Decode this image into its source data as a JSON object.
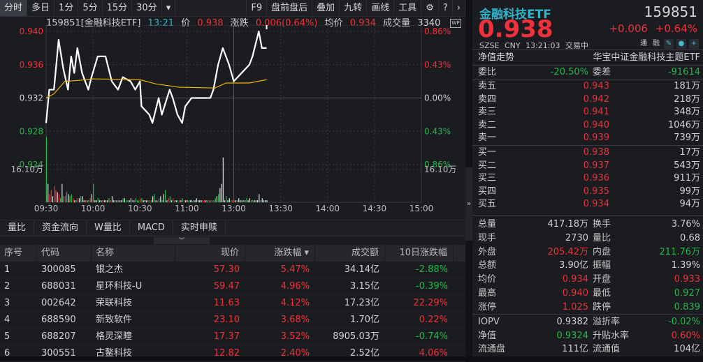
{
  "toolbar": {
    "left": [
      "分时",
      "多日",
      "1分",
      "5分",
      "15分",
      "30分"
    ],
    "more": "▾",
    "right": [
      "F9",
      "盘前盘后",
      "叠加",
      "九转",
      "画线",
      "工具"
    ],
    "icons": [
      "gear-icon",
      "help-icon",
      "chevron-right-icon"
    ]
  },
  "chart_header": {
    "code_name": "159851[金融科技ETF]",
    "time": "13:21",
    "price_label": "价",
    "price": "0.938",
    "change_label": "涨跌",
    "change": "0.006(0.64%)",
    "avg_label": "均价",
    "avg": "0.934",
    "vol_label": "成交量",
    "vol": "3340",
    "wp": "WP"
  },
  "chart_data": {
    "type": "line",
    "title": "159851 分时",
    "x_ticks": [
      "09:30",
      "10:00",
      "10:30",
      "11:00",
      "13:00",
      "13:30",
      "14:00",
      "14:30",
      "15:00"
    ],
    "y_left_ticks": [
      "0.940",
      "0.936",
      "0.932",
      "0.928",
      "0.924"
    ],
    "y_right_ticks": [
      "0.86%",
      "0.43%",
      "0.00%",
      "0.43%",
      "0.86%"
    ],
    "ylim": [
      0.924,
      0.94
    ],
    "prev_close": 0.932,
    "volume_label": "16.10万",
    "volume_ref": 16.1,
    "price": {
      "minutes": [
        0,
        2,
        5,
        8,
        11,
        14,
        16,
        18,
        20,
        23,
        27,
        29,
        33,
        38,
        42,
        46,
        49,
        54,
        57,
        60,
        61,
        66,
        68,
        72,
        74,
        79,
        81,
        84,
        87,
        89,
        93,
        96,
        101,
        105,
        107,
        110,
        113,
        117,
        120,
        125,
        130,
        132,
        136,
        138,
        141
      ],
      "values": [
        0.929,
        0.933,
        0.933,
        0.939,
        0.9355,
        0.933,
        0.937,
        0.935,
        0.938,
        0.935,
        0.933,
        0.9345,
        0.937,
        0.937,
        0.934,
        0.933,
        0.9345,
        0.934,
        0.933,
        0.934,
        0.931,
        0.93,
        0.929,
        0.932,
        0.93,
        0.933,
        0.932,
        0.93,
        0.929,
        0.931,
        0.932,
        0.932,
        0.932,
        0.932,
        0.933,
        0.936,
        0.938,
        0.936,
        0.934,
        0.935,
        0.936,
        0.937,
        0.94,
        0.938,
        0.938
      ]
    },
    "avg": {
      "minutes": [
        0,
        5,
        12,
        20,
        30,
        60,
        70,
        85,
        108,
        115,
        130,
        141
      ],
      "values": [
        0.932,
        0.9325,
        0.934,
        0.9341,
        0.9343,
        0.9342,
        0.9337,
        0.9333,
        0.9332,
        0.9338,
        0.9338,
        0.9342
      ]
    },
    "volume": [
      32,
      9,
      4,
      6,
      3,
      8,
      6,
      5,
      4,
      2,
      9,
      3,
      3,
      5,
      4,
      3,
      4,
      2,
      1,
      1,
      2,
      2,
      3,
      3,
      1,
      1,
      1,
      1,
      2,
      4,
      9,
      1,
      1,
      2,
      1,
      1,
      1,
      1,
      1,
      1,
      2,
      1,
      3,
      1,
      1,
      1,
      1,
      1,
      1,
      2,
      2,
      1,
      1,
      1,
      2,
      1,
      1,
      2,
      1,
      1,
      2,
      2,
      1,
      1,
      1,
      1,
      1,
      1,
      3,
      4,
      1,
      1,
      2,
      3,
      1,
      4,
      6,
      1,
      2,
      3,
      1,
      2,
      1,
      1,
      1,
      1,
      1,
      2,
      1,
      1,
      1,
      1,
      1,
      1,
      1,
      1,
      2,
      1,
      1,
      1,
      1,
      1,
      1,
      1,
      1,
      1,
      1,
      1,
      2,
      3,
      4,
      7,
      9,
      22,
      1,
      3,
      1,
      2,
      1,
      1,
      1,
      1,
      1,
      2,
      1,
      1,
      1,
      1,
      2,
      1,
      2,
      1,
      1,
      1,
      1,
      1,
      4,
      1,
      2,
      1,
      1,
      1
    ],
    "volume_colors": "gwrrwrrwrgwgrgwggrwgrwgwwrwgrwgwwgwwrwwwgrwwgwrwwgwggwwgwgggrgwwwgrgwgwrgwgwgwrgwrgwgrwgrwwgwwgwwwwwrrwgrrrggwgwwwwgwwgrrwgwwwgwgwwggwwwwg"
  },
  "bottom_tabs": [
    "量比",
    "资金流向",
    "W量比",
    "MACD",
    "实时申赎"
  ],
  "table": {
    "headers": [
      "序号",
      "代码",
      "名称",
      "现价",
      "涨跌幅 ▾",
      "成交额",
      "10日涨跌幅"
    ],
    "rows": [
      {
        "no": "1",
        "code": "300085",
        "name": "银之杰",
        "price": "57.30",
        "pct": "5.47%",
        "amount": "34.14亿",
        "pct10": "-2.88%",
        "pct10_up": false
      },
      {
        "no": "2",
        "code": "688031",
        "name": "星环科技-U",
        "price": "59.47",
        "pct": "4.96%",
        "amount": "3.15亿",
        "pct10": "-0.39%",
        "pct10_up": false
      },
      {
        "no": "3",
        "code": "002642",
        "name": "荣联科技",
        "price": "11.63",
        "pct": "4.12%",
        "amount": "17.23亿",
        "pct10": "22.29%",
        "pct10_up": true
      },
      {
        "no": "4",
        "code": "688590",
        "name": "新致软件",
        "price": "23.10",
        "pct": "3.68%",
        "amount": "1.70亿",
        "pct10": "0.22%",
        "pct10_up": true
      },
      {
        "no": "5",
        "code": "688207",
        "name": "格灵深瞳",
        "price": "17.37",
        "pct": "3.52%",
        "amount": "8905.03万",
        "pct10": "-0.74%",
        "pct10_up": false
      },
      {
        "no": "6",
        "code": "300551",
        "name": "古鳌科技",
        "price": "12.82",
        "pct": "2.40%",
        "amount": "2.52亿",
        "pct10": "4.06%",
        "pct10_up": true
      }
    ]
  },
  "quote": {
    "name": "金融科技ETF",
    "code": "159851",
    "price": "0.938",
    "change": "+0.006",
    "change_pct": "+0.64%",
    "exchange": "SZSE",
    "currency": "CNY",
    "time": "13:21:03",
    "status": "交易中",
    "tags": [
      "通",
      "融"
    ],
    "nav_trend": "净值走势",
    "full_name": "华宝中证金融科技主题ETF",
    "weibi_label": "委比",
    "weibi": "-20.50%",
    "weicha_label": "委差",
    "weicha": "-91614",
    "asks": [
      {
        "label": "卖五",
        "price": "0.943",
        "qty": "181万"
      },
      {
        "label": "卖四",
        "price": "0.942",
        "qty": "218万"
      },
      {
        "label": "卖三",
        "price": "0.941",
        "qty": "348万"
      },
      {
        "label": "卖二",
        "price": "0.940",
        "qty": "1046万"
      },
      {
        "label": "卖一",
        "price": "0.939",
        "qty": "739万"
      }
    ],
    "bids": [
      {
        "label": "买一",
        "price": "0.938",
        "qty": "17万"
      },
      {
        "label": "买二",
        "price": "0.937",
        "qty": "543万"
      },
      {
        "label": "买三",
        "price": "0.936",
        "qty": "911万"
      },
      {
        "label": "买四",
        "price": "0.935",
        "qty": "99万"
      },
      {
        "label": "买五",
        "price": "0.934",
        "qty": "94万"
      }
    ],
    "stats": [
      {
        "k1": "总量",
        "v1": "417.18万",
        "c1": "",
        "k2": "换手",
        "v2": "3.76%",
        "c2": ""
      },
      {
        "k1": "现手",
        "v1": "2730",
        "c1": "",
        "k2": "量比",
        "v2": "0.68",
        "c2": ""
      },
      {
        "k1": "外盘",
        "v1": "205.42万",
        "c1": "red",
        "k2": "内盘",
        "v2": "211.76万",
        "c2": "green"
      },
      {
        "k1": "总额",
        "v1": "3.90亿",
        "c1": "",
        "k2": "振幅",
        "v2": "1.39%",
        "c2": ""
      },
      {
        "k1": "均价",
        "v1": "0.934",
        "c1": "red",
        "k2": "开盘",
        "v2": "0.933",
        "c2": "red"
      },
      {
        "k1": "最高",
        "v1": "0.940",
        "c1": "red",
        "k2": "最低",
        "v2": "0.927",
        "c2": "green"
      },
      {
        "k1": "涨停",
        "v1": "1.025",
        "c1": "red",
        "k2": "跌停",
        "v2": "0.839",
        "c2": "green"
      }
    ],
    "etf": [
      {
        "k1": "IOPV",
        "v1": "0.9382",
        "c1": "",
        "k2": "溢折率",
        "v2": "-0.02%",
        "c2": "green"
      },
      {
        "k1": "净值",
        "v1": "0.9324",
        "c1": "green",
        "k2": "升贴水率",
        "v2": "0.60%",
        "c2": "red"
      },
      {
        "k1": "流通盘",
        "v1": "111亿",
        "c1": "",
        "k2": "流通值",
        "v2": "104亿",
        "c2": ""
      }
    ]
  },
  "colors": {
    "up": "#f0303a",
    "down": "#20b84a",
    "title": "#2fb3c9",
    "avg": "#f0b000"
  }
}
